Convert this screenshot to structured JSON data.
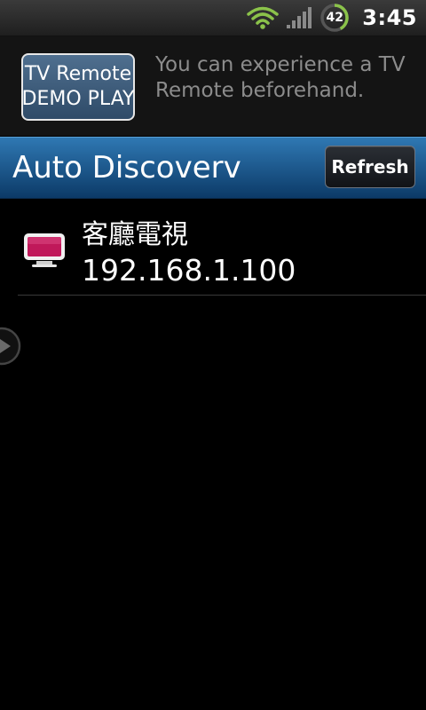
{
  "status_bar": {
    "time": "3:45",
    "battery_level": "42",
    "battery_fraction": 0.42
  },
  "demo": {
    "button_line1": "TV Remote",
    "button_line2": "DEMO PLAY",
    "description": "You can experience a TV Remote beforehand."
  },
  "header": {
    "title": "Auto Discoverv",
    "refresh_label": "Refresh"
  },
  "devices": [
    {
      "name": "客廳電視",
      "ip": "192.168.1.100",
      "icon": "tv-icon"
    }
  ],
  "colors": {
    "header_blue": "#1d5e95",
    "wifi_green": "#8bc34a",
    "tv_pink": "#c0185a"
  }
}
